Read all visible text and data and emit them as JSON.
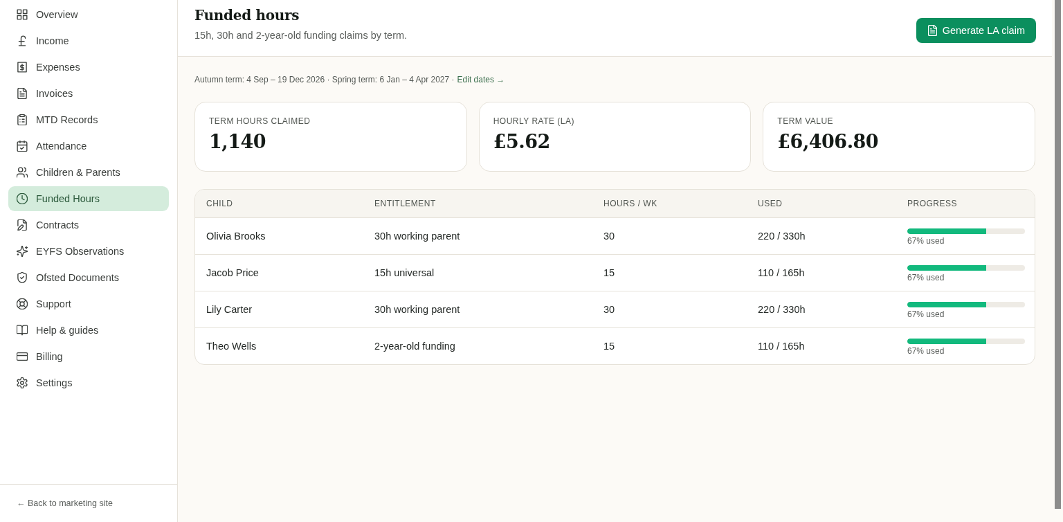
{
  "sidebar": {
    "items": [
      {
        "label": "Overview",
        "selected": false
      },
      {
        "label": "Income",
        "selected": false
      },
      {
        "label": "Expenses",
        "selected": false
      },
      {
        "label": "Invoices",
        "selected": false
      },
      {
        "label": "MTD Records",
        "selected": false
      },
      {
        "label": "Attendance",
        "selected": false
      },
      {
        "label": "Children & Parents",
        "selected": false
      },
      {
        "label": "Funded Hours",
        "selected": true
      },
      {
        "label": "Contracts",
        "selected": false
      },
      {
        "label": "EYFS Observations",
        "selected": false
      },
      {
        "label": "Ofsted Documents",
        "selected": false
      },
      {
        "label": "Support",
        "selected": false
      },
      {
        "label": "Help & guides",
        "selected": false
      },
      {
        "label": "Billing",
        "selected": false
      },
      {
        "label": "Settings",
        "selected": false
      }
    ],
    "back_link": "← Back to marketing site"
  },
  "header": {
    "title": "Funded hours",
    "subtitle": "15h, 30h and 2-year-old funding claims by term.",
    "action_button": "Generate LA claim"
  },
  "term_dates": {
    "text": "Autumn term: 4 Sep – 19 Dec 2026 · Spring term: 6 Jan – 4 Apr 2027 ·",
    "link": "Edit dates →"
  },
  "stats": [
    {
      "label": "TERM HOURS CLAIMED",
      "value": "1,140"
    },
    {
      "label": "HOURLY RATE (LA)",
      "value": "£5.62"
    },
    {
      "label": "TERM VALUE",
      "value": "£6,406.80"
    }
  ],
  "table": {
    "columns": [
      "CHILD",
      "ENTITLEMENT",
      "HOURS / WK",
      "USED",
      "PROGRESS"
    ],
    "rows": [
      {
        "child": "Olivia Brooks",
        "entitlement": "30h working parent",
        "hours_per_week": "30",
        "used": "220 / 330h",
        "level": 0.67,
        "reading": "67% used"
      },
      {
        "child": "Jacob Price",
        "entitlement": "15h universal",
        "hours_per_week": "15",
        "used": "110 / 165h",
        "level": 0.67,
        "reading": "67% used"
      },
      {
        "child": "Lily Carter",
        "entitlement": "30h working parent",
        "hours_per_week": "30",
        "used": "220 / 330h",
        "level": 0.67,
        "reading": "67% used"
      },
      {
        "child": "Theo Wells",
        "entitlement": "2-year-old funding",
        "hours_per_week": "15",
        "used": "110 / 165h",
        "level": 0.67,
        "reading": "67% used"
      }
    ]
  }
}
